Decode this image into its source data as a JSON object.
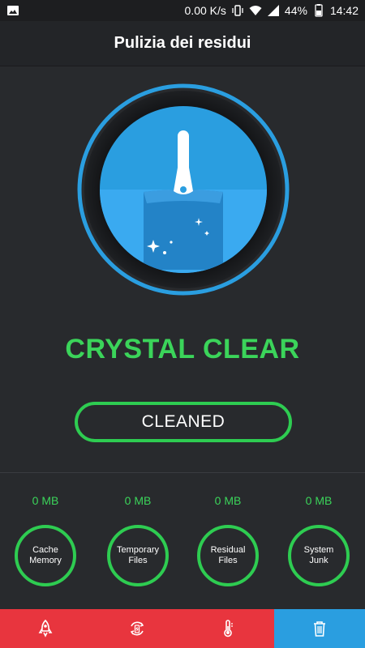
{
  "status_bar": {
    "network_speed": "0.00 K/s",
    "battery": "44%",
    "time": "14:42",
    "icons": [
      "image-icon",
      "vibrate-icon",
      "wifi-icon",
      "signal-icon",
      "battery-icon"
    ]
  },
  "header": {
    "title": "Pulizia dei residui"
  },
  "hero": {
    "icon": "broom-icon"
  },
  "status_headline": "CRYSTAL CLEAR",
  "action": {
    "label": "CLEANED"
  },
  "stats": [
    {
      "value": "0 MB",
      "label": "Cache\nMemory"
    },
    {
      "value": "0 MB",
      "label": "Temporary\nFiles"
    },
    {
      "value": "0 MB",
      "label": "Residual\nFiles"
    },
    {
      "value": "0 MB",
      "label": "System\nJunk"
    }
  ],
  "bottom_nav": {
    "tabs": [
      {
        "icon": "rocket-icon",
        "active": false
      },
      {
        "icon": "battery-cycle-icon",
        "active": false
      },
      {
        "icon": "thermometer-icon",
        "active": false
      },
      {
        "icon": "trash-icon",
        "active": true
      }
    ]
  },
  "colors": {
    "accent_green": "#2ecc51",
    "accent_blue": "#2a9ee0",
    "nav_red": "#e8353e",
    "background": "#282a2d"
  }
}
